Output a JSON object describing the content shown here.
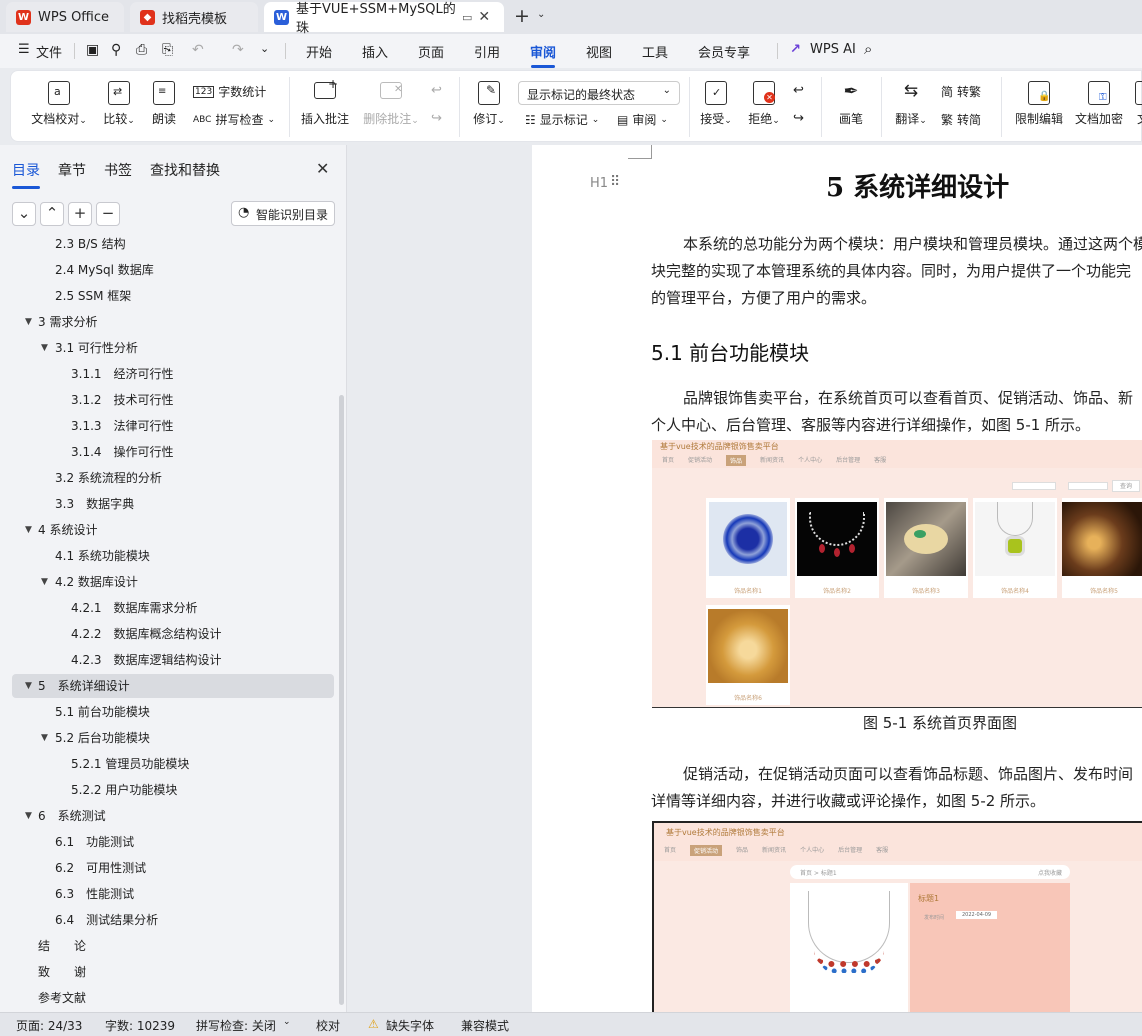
{
  "tabs": [
    {
      "label": "WPS Office",
      "icon": "wps-logo-icon"
    },
    {
      "label": "找稻壳模板",
      "icon": "docer-icon"
    },
    {
      "label": "基于VUE+SSM+MySQL的珠",
      "icon": "word-doc-icon"
    }
  ],
  "menubar": {
    "file": "文件",
    "items": [
      "开始",
      "插入",
      "页面",
      "引用",
      "审阅",
      "视图",
      "工具",
      "会员专享"
    ],
    "active": "审阅",
    "wps_ai": "WPS AI"
  },
  "ribbon": {
    "doc_check": "文档校对",
    "compare": "比较",
    "read": "朗读",
    "word_count": "字数统计",
    "spell_check": "拼写检查",
    "insert_comment": "插入批注",
    "delete_comment": "删除批注",
    "track": "修订",
    "markup_state": "显示标记的最终状态",
    "show_markup": "显示标记",
    "review": "审阅",
    "accept": "接受",
    "reject": "拒绝",
    "pen": "画笔",
    "translate": "翻译",
    "to_trad": "转繁",
    "to_simp": "转简",
    "restrict_edit": "限制编辑",
    "encrypt": "文档加密",
    "more": "文"
  },
  "nav": {
    "tabs": [
      "目录",
      "章节",
      "书签",
      "查找和替换"
    ],
    "smart": "智能识别目录",
    "toc": [
      {
        "text": "2.3 B/S 结构",
        "level": 2
      },
      {
        "text": "2.4 MySql 数据库",
        "level": 2
      },
      {
        "text": "2.5 SSM 框架",
        "level": 2
      },
      {
        "text": "3 需求分析",
        "level": 1,
        "caret": true
      },
      {
        "text": "3.1 可行性分析",
        "level": 2,
        "caret": true
      },
      {
        "text": "3.1.1　经济可行性",
        "level": 3
      },
      {
        "text": "3.1.2　技术可行性",
        "level": 3
      },
      {
        "text": "3.1.3　法律可行性",
        "level": 3
      },
      {
        "text": "3.1.4　操作可行性",
        "level": 3
      },
      {
        "text": "3.2 系统流程的分析",
        "level": 2
      },
      {
        "text": "3.3　数据字典",
        "level": 2
      },
      {
        "text": "4 系统设计",
        "level": 1,
        "caret": true
      },
      {
        "text": "4.1 系统功能模块",
        "level": 2
      },
      {
        "text": "4.2 数据库设计",
        "level": 2,
        "caret": true
      },
      {
        "text": "4.2.1　数据库需求分析",
        "level": 3
      },
      {
        "text": "4.2.2　数据库概念结构设计",
        "level": 3
      },
      {
        "text": "4.2.3　数据库逻辑结构设计",
        "level": 3
      },
      {
        "text": "5　系统详细设计",
        "level": 1,
        "caret": true,
        "selected": true
      },
      {
        "text": "5.1 前台功能模块",
        "level": 2
      },
      {
        "text": "5.2 后台功能模块",
        "level": 2,
        "caret": true
      },
      {
        "text": "5.2.1 管理员功能模块",
        "level": 3
      },
      {
        "text": "5.2.2 用户功能模块",
        "level": 3
      },
      {
        "text": "6　系统测试",
        "level": 1,
        "caret": true
      },
      {
        "text": "6.1　功能测试",
        "level": 2
      },
      {
        "text": "6.2　可用性测试",
        "level": 2
      },
      {
        "text": "6.3　性能测试",
        "level": 2
      },
      {
        "text": "6.4　测试结果分析",
        "level": 2
      },
      {
        "text": "结　　论",
        "level": 1
      },
      {
        "text": "致　　谢",
        "level": 1
      },
      {
        "text": "参考文献",
        "level": 1
      }
    ]
  },
  "document": {
    "heading_marker": "H1",
    "title": "5  系统详细设计",
    "p1": [
      "本系统的总功能分为两个模块：用户模块和管理员模块。通过这两个模",
      "块完整的实现了本管理系统的具体内容。同时，为用户提供了一个功能完",
      "的管理平台，方便了用户的需求。"
    ],
    "h2": "5.1 前台功能模块",
    "p2": [
      "品牌银饰售卖平台，在系统首页可以查看首页、促销活动、饰品、新",
      "个人中心、后台管理、客服等内容进行详细操作，如图 5-1 所示。"
    ],
    "fig1": {
      "site_title": "基于vue技术的品牌银饰售卖平台",
      "nav": [
        "首页",
        "促销活动",
        "饰品",
        "新闻资讯",
        "个人中心",
        "后台管理",
        "客服"
      ],
      "products": [
        "饰品名称1",
        "饰品名称2",
        "饰品名称3",
        "饰品名称4",
        "饰品名称5",
        "饰品名称6"
      ],
      "search": "查询",
      "caption": "图 5-1 系统首页界面图"
    },
    "p3": [
      "促销活动，在促销活动页面可以查看饰品标题、饰品图片、发布时间",
      "详情等详细内容，并进行收藏或评论操作，如图 5-2 所示。"
    ],
    "fig2": {
      "site_title": "基于vue技术的品牌银饰售卖平台",
      "nav": [
        "首页",
        "促销活动",
        "饰品",
        "新闻资讯",
        "个人中心",
        "后台管理",
        "客服"
      ],
      "breadcrumb": [
        "首页",
        "标题1"
      ],
      "collect": "点我收藏",
      "detail_title": "标题1",
      "date_label": "发布时间",
      "date": "2022-04-09"
    }
  },
  "status": {
    "page": "页面: 24/33",
    "words": "字数: 10239",
    "spell": "拼写检查: 关闭",
    "proof": "校对",
    "missing_font": "缺失字体",
    "compat": "兼容模式"
  },
  "colors": {
    "accent": "#1a57d6",
    "wps_red": "#e0321b",
    "banner": "#fbe9e3"
  }
}
